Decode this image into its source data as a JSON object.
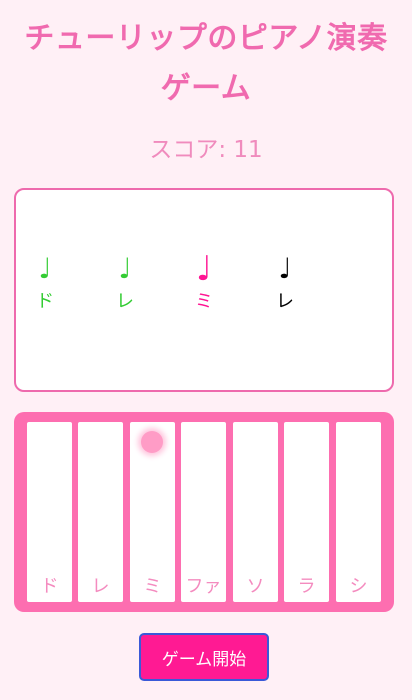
{
  "header": {
    "title_line1": "チューリップのピアノ演奏",
    "title_line2": "ゲーム"
  },
  "score": {
    "text": "スコア: 11",
    "value": 11
  },
  "notes": [
    {
      "glyph": "♩",
      "label": "ド",
      "color": "#33cc33",
      "state": "correct"
    },
    {
      "glyph": "♩",
      "label": "レ",
      "color": "#33cc33",
      "state": "correct"
    },
    {
      "glyph": "♩",
      "label": "ミ",
      "color": "#ff1493",
      "state": "current"
    },
    {
      "glyph": "♩",
      "label": "レ",
      "color": "#000000",
      "state": "upcoming"
    }
  ],
  "keys": [
    {
      "label": "ド"
    },
    {
      "label": "レ"
    },
    {
      "label": "ミ",
      "pressed": true
    },
    {
      "label": "ファ"
    },
    {
      "label": "ソ"
    },
    {
      "label": "ラ"
    },
    {
      "label": "シ"
    }
  ],
  "controls": {
    "start_label": "ゲーム開始"
  },
  "colors": {
    "accent": "#ff1493",
    "keyboard_bg": "#fd6eb0",
    "page_bg": "#fff0f6"
  }
}
